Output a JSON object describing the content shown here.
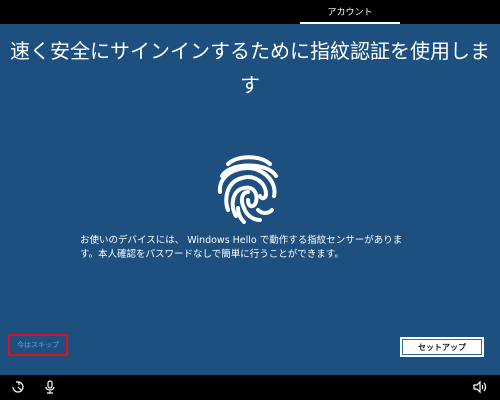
{
  "header": {
    "tab_label": "アカウント"
  },
  "main": {
    "title": "速く安全にサインインするために指紋認証を使用します",
    "description": "お使いのデバイスには、 Windows Hello で動作する指紋センサーがあります。本人確認をパスワードなしで簡単に行うことができます。",
    "fingerprint_icon": "fingerprint-icon"
  },
  "actions": {
    "skip_label": "今はスキップ",
    "setup_label": "セットアップ"
  },
  "taskbar": {
    "left_icons": [
      "ease-of-access-icon",
      "microphone-icon"
    ],
    "right_icons": [
      "volume-icon"
    ]
  },
  "colors": {
    "panel_blue": "#1d4f7f",
    "skip_text": "#5ea6e6",
    "highlight_red": "#e0101e"
  }
}
